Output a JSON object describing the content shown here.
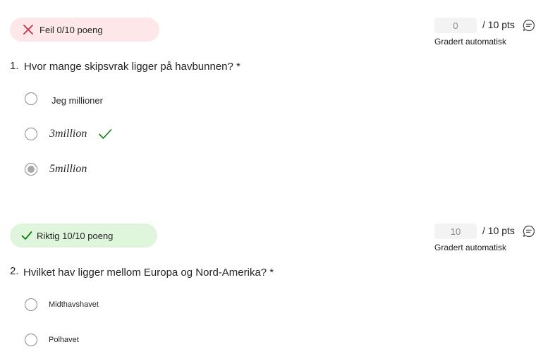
{
  "questions": [
    {
      "badge": "Feil 0/10 poeng",
      "score_value": "0",
      "points_suffix": "/ 10 pts",
      "graded_label": "Gradert automatisk",
      "number": "1.",
      "text": "Hvor mange skipsvrak ligger på havbunnen? *",
      "options": [
        {
          "label": "Jeg millioner",
          "selected": false,
          "correct": false
        },
        {
          "label": "3million",
          "selected": false,
          "correct": true
        },
        {
          "label": "5million",
          "selected": true,
          "correct": false
        }
      ]
    },
    {
      "badge": "Riktig 10/10 poeng",
      "score_value": "10",
      "points_suffix": "/ 10 pts",
      "graded_label": "Gradert automatisk",
      "number": "2.",
      "text": "Hvilket hav ligger mellom Europa og Nord-Amerika? *",
      "options": [
        {
          "label": "Midthavshavet",
          "selected": false,
          "correct": false
        },
        {
          "label": "Polhavet",
          "selected": false,
          "correct": false
        }
      ]
    }
  ],
  "icons": {
    "wrong": "x-icon",
    "right": "checkmark-icon",
    "comment": "comment-icon",
    "correct_answer": "checkmark-icon"
  },
  "colors": {
    "wrong_badge_bg": "#fde7e9",
    "wrong_icon": "#c4314b",
    "right_badge_bg": "#dff6dd",
    "right_icon": "#107c10"
  }
}
